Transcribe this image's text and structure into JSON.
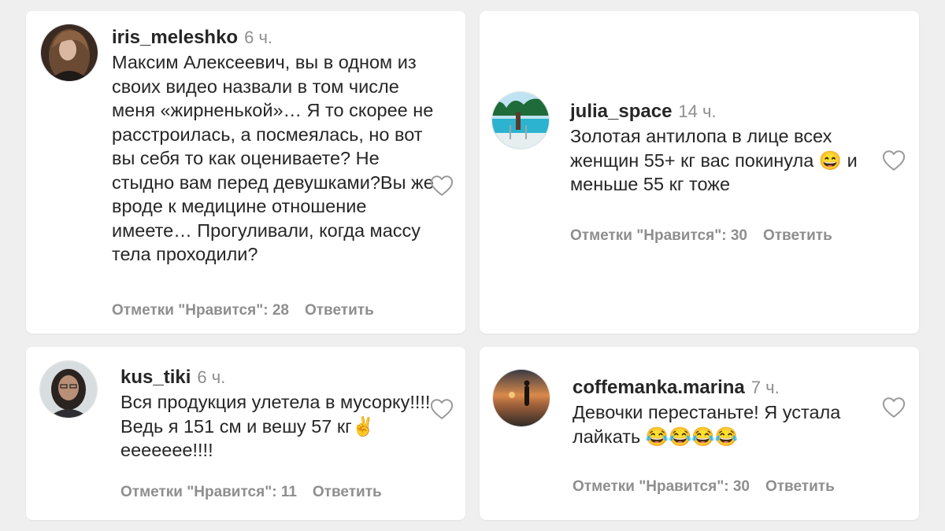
{
  "comments": [
    {
      "username": "iris_meleshko",
      "time": "6 ч.",
      "text": "Максим Алексеевич, вы в одном из своих видео назвали в том числе меня «жирненькой»… Я то скорее не расстроилась, а посмеялась, но вот вы себя то как оцениваете? Не стыдно вам перед девушками?Вы же вроде к медицине отношение имеете… Прогуливали, когда массу тела проходили?",
      "likes_label": "Отметки \"Нравится\": 28",
      "reply_label": "Ответить"
    },
    {
      "username": "julia_space",
      "time": "14 ч.",
      "text": "Золотая антилопа в лице всех женщин 55+ кг вас покинула 😄 и меньше 55 кг тоже",
      "likes_label": "Отметки \"Нравится\": 30",
      "reply_label": "Ответить"
    },
    {
      "username": "kus_tiki",
      "time": "6 ч.",
      "text": "Вся продукция улетела в мусорку!!!! Ведь я 151 см и вешу 57 кг✌️ еееееее!!!!",
      "likes_label": "Отметки \"Нравится\": 11",
      "reply_label": "Ответить"
    },
    {
      "username": "coffemanka.marina",
      "time": "7 ч.",
      "text": "Девочки перестаньте! Я устала лайкать 😂😂😂😂",
      "likes_label": "Отметки \"Нравится\": 30",
      "reply_label": "Ответить"
    }
  ],
  "icons": {
    "like": "heart-outline-icon"
  },
  "colors": {
    "text": "#262626",
    "muted": "#8e8e8e",
    "background": "#efefef",
    "card": "#ffffff"
  }
}
